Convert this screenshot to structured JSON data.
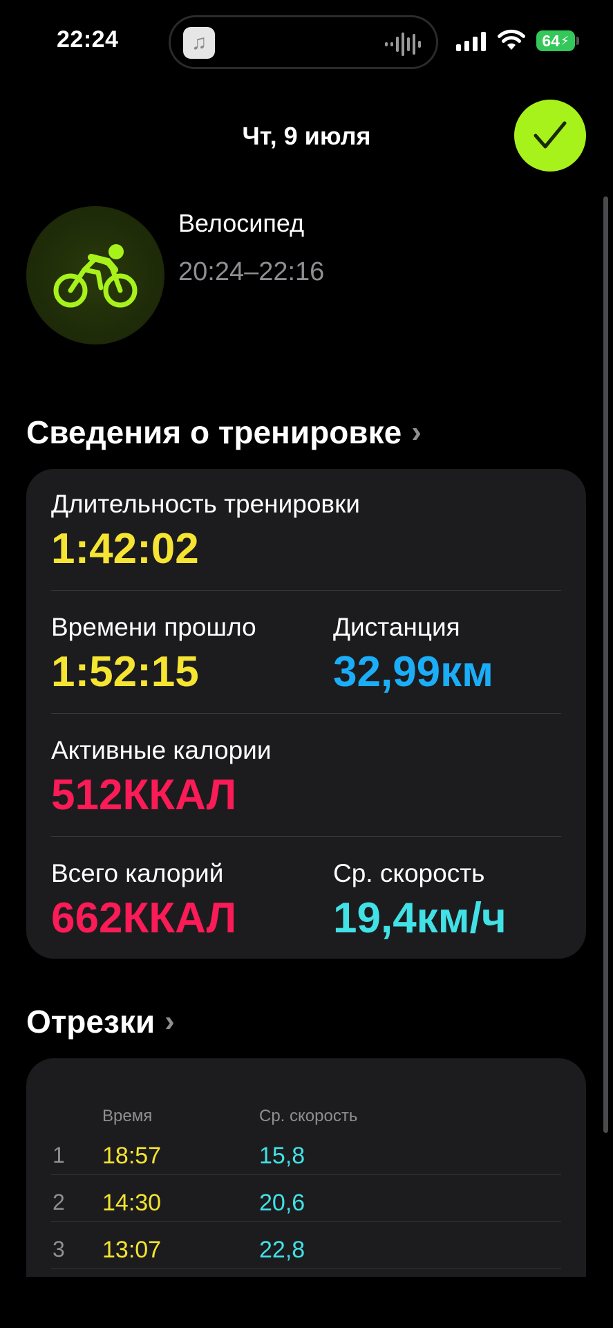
{
  "status_bar": {
    "time": "22:24",
    "battery": "64",
    "island_app_icon": "music-note-icon"
  },
  "header": {
    "date": "Чт, 9 июля",
    "done_icon": "checkmark-icon"
  },
  "workout": {
    "icon": "bicycle-icon",
    "name": "Велосипед",
    "time_range": "20:24–22:16",
    "accent": "#a8f21b"
  },
  "details": {
    "title": "Сведения о тренировке",
    "duration": {
      "label": "Длительность тренировки",
      "value": "1:42:02"
    },
    "elapsed": {
      "label": "Времени прошло",
      "value": "1:52:15"
    },
    "distance": {
      "label": "Дистанция",
      "value": "32,99км"
    },
    "active_calories": {
      "label": "Активные калории",
      "value": "512ККАЛ"
    },
    "total_calories": {
      "label": "Всего калорий",
      "value": "662ККАЛ"
    },
    "avg_speed": {
      "label": "Ср. скорость",
      "value": "19,4км/ч"
    }
  },
  "splits": {
    "title": "Отрезки",
    "columns": [
      "Время",
      "Ср. скорость"
    ],
    "rows": [
      {
        "index": "1",
        "time": "18:57",
        "speed": "15,8"
      },
      {
        "index": "2",
        "time": "14:30",
        "speed": "20,6"
      },
      {
        "index": "3",
        "time": "13:07",
        "speed": "22,8"
      }
    ]
  },
  "colors": {
    "time_yellow": "#f5e431",
    "distance_blue": "#1badf8",
    "calories_red": "#fa1b57",
    "speed_cyan": "#41e1e6",
    "background": "#000000",
    "card": "#1c1c1e"
  }
}
